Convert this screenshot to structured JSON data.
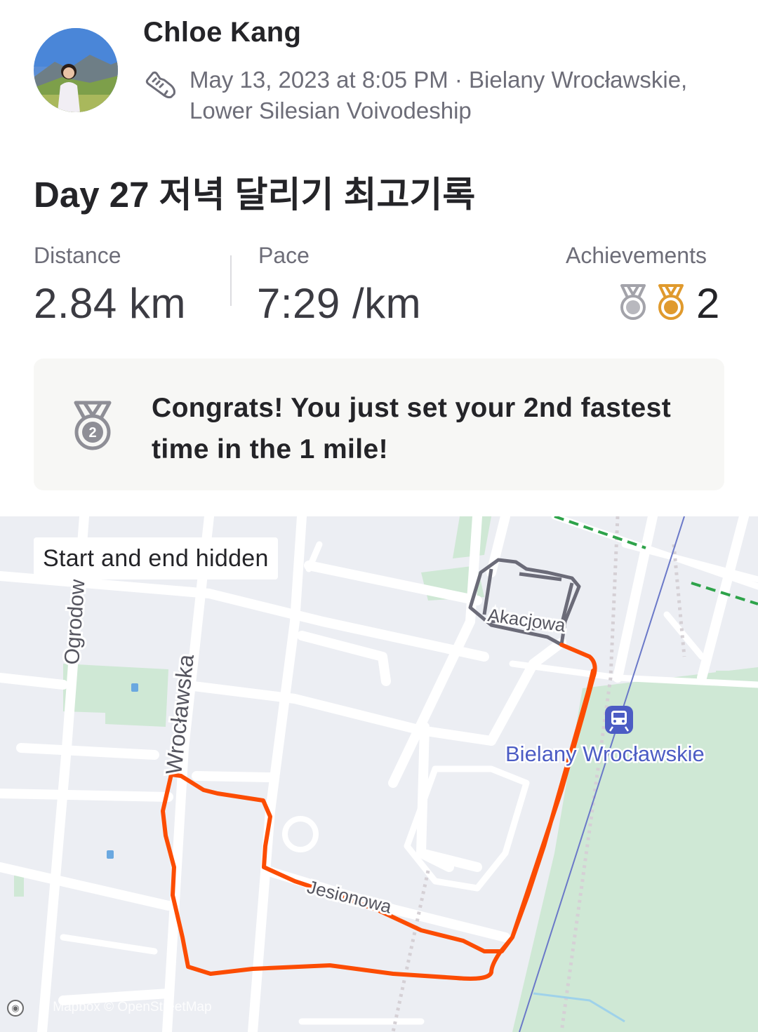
{
  "athlete": {
    "name": "Chloe Kang",
    "avatar_icon": "avatar-photo"
  },
  "activity": {
    "sport_icon": "shoe-icon",
    "meta": "May 13, 2023 at 8:05 PM · Bielany Wrocławskie, Lower Silesian Voivodeship",
    "title": "Day 27 저녁 달리기 최고기록"
  },
  "stats": {
    "distance": {
      "label": "Distance",
      "value": "2.84 km"
    },
    "pace": {
      "label": "Pace",
      "value": "7:29 /km"
    },
    "achievements": {
      "label": "Achievements",
      "count": "2",
      "medals": [
        "silver-medal",
        "bronze-medal"
      ]
    }
  },
  "banner": {
    "icon": "medal-2nd-icon",
    "medal_number": "2",
    "text": "Congrats! You just set your 2nd fastest time in the 1 mile!"
  },
  "map": {
    "privacy_label": "Start and end hidden",
    "street_labels": [
      "Ogrodowa",
      "Wrocławska",
      "Akacjowa",
      "Jesionowa"
    ],
    "place_label": "Bielany Wrocławskie",
    "attribution": "© Mapbox © OpenStreetMap",
    "route_color": "#fc4c02",
    "hidden_route_color": "#6b6b78"
  },
  "colors": {
    "silver": "#b8b8be",
    "bronze": "#e09a2d",
    "text": "#242428",
    "muted": "#6d6d78"
  }
}
